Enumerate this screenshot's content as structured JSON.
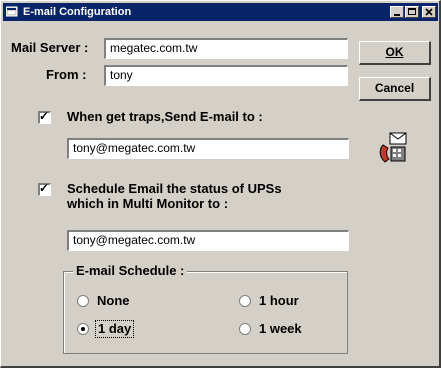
{
  "window": {
    "title": "E-mail Configuration",
    "controls": [
      "minimize-icon",
      "maximize-icon",
      "close-icon"
    ]
  },
  "form": {
    "mail_server_label": "Mail Server :",
    "mail_server_value": "megatec.com.tw",
    "from_label": "From :",
    "from_value": "tony"
  },
  "buttons": {
    "ok_label": "OK",
    "cancel_label": "Cancel"
  },
  "notify": {
    "checked": true,
    "label": "When get traps,Send E-mail to :",
    "value": "tony@megatec.com.tw"
  },
  "schedule": {
    "checked": true,
    "label_line1": "Schedule Email the status of UPSs",
    "label_line2": "which in Multi Monitor to :",
    "value": "tony@megatec.com.tw"
  },
  "email_schedule": {
    "title": "E-mail Schedule :",
    "options": [
      {
        "label": "None",
        "selected": false
      },
      {
        "label": "1 hour",
        "selected": false
      },
      {
        "label": "1 day",
        "selected": true
      },
      {
        "label": "1 week",
        "selected": false
      }
    ]
  },
  "icons": {
    "app": "app-window-icon",
    "mail": "mail-phone-icon"
  }
}
